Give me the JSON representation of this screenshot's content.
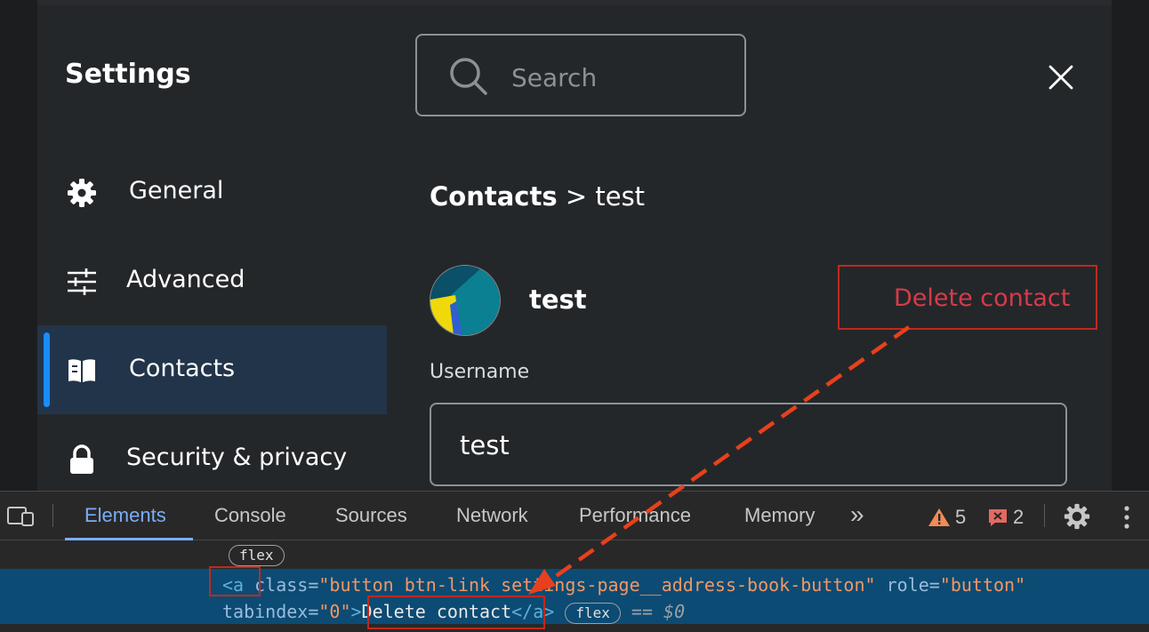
{
  "settings": {
    "title": "Settings",
    "search_placeholder": "Search",
    "nav": [
      {
        "label": "General",
        "icon": "gear-icon"
      },
      {
        "label": "Advanced",
        "icon": "sliders-icon"
      },
      {
        "label": "Contacts",
        "icon": "book-icon",
        "active": true
      },
      {
        "label": "Security & privacy",
        "icon": "lock-icon"
      }
    ],
    "breadcrumb": {
      "root": "Contacts",
      "separator": ">",
      "leaf": "test"
    },
    "contact": {
      "name": "test",
      "delete_label": "Delete contact",
      "username_label": "Username",
      "username_value": "test"
    }
  },
  "devtools": {
    "tabs": [
      "Elements",
      "Console",
      "Sources",
      "Network",
      "Performance",
      "Memory"
    ],
    "active_tab": "Elements",
    "more_tabs": "»",
    "warnings": "5",
    "errors": "2",
    "flex_badge": "flex",
    "code": {
      "open_tag": "<a",
      "attr_class": " class=",
      "class_value": "\"button btn-link settings-page__address-book-button\"",
      "attr_role": " role=",
      "role_value": "\"button\"",
      "attr_tabindex": "tabindex=",
      "tabindex_value": "\"0\"",
      "gt": ">",
      "text": "Delete contact",
      "close_tag": "</a>",
      "eq": " == ",
      "dollar": "$0"
    }
  },
  "colors": {
    "accent": "#1a8cff",
    "danger": "#d73a4a",
    "annotation": "#c0291d",
    "arrow": "#e8401c",
    "selected_row": "#0c4b73"
  }
}
